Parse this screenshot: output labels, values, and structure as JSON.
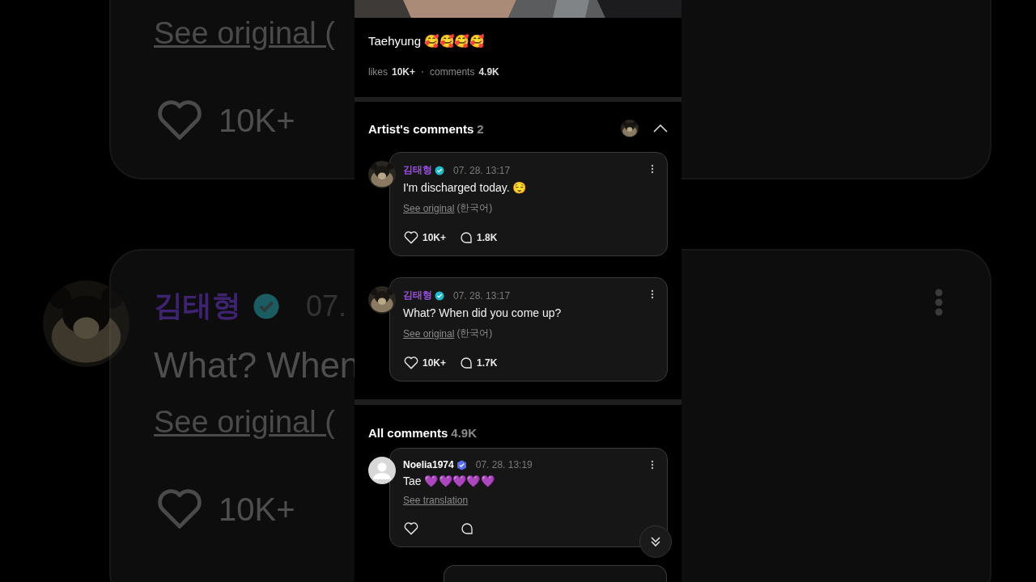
{
  "backdrop": {
    "cards": [
      {
        "kind": "partial",
        "link": "See original (",
        "likes": "10K+"
      },
      {
        "kind": "full",
        "author": "김태형",
        "time": "07.",
        "text": "What? When",
        "link": "See original (",
        "likes": "10K+"
      }
    ]
  },
  "post": {
    "caption": "Taehyung 🥰🥰🥰🥰",
    "likes_label": "likes",
    "likes": "10K+",
    "comments_label": "comments",
    "comments": "4.9K"
  },
  "artist_comments": {
    "title": "Artist's comments",
    "count": "2",
    "expanded": true,
    "comments": [
      {
        "kind": "artist",
        "author": "김태형",
        "time": "07. 28. 13:17",
        "text": "I'm discharged today. 😌",
        "link": "See original",
        "link_note": "(한국어)",
        "likes": "10K+",
        "replies": "1.8K"
      },
      {
        "kind": "artist",
        "author": "김태형",
        "time": "07. 28. 13:17",
        "text": "What? When did you come up?",
        "link": "See original",
        "link_note": "(한국어)",
        "likes": "10K+",
        "replies": "1.7K"
      }
    ]
  },
  "all_comments": {
    "title": "All comments",
    "count": "4.9K",
    "comments": [
      {
        "kind": "fan",
        "author": "Noelia1974",
        "time": "07. 28. 13:19",
        "text": "Tae 💜💜💜💜💜",
        "link": "See translation"
      }
    ]
  }
}
